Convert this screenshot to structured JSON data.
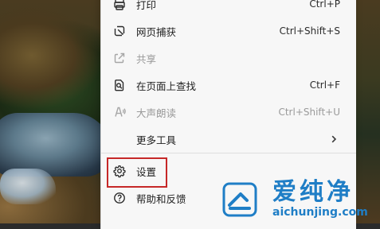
{
  "menu": {
    "items": [
      {
        "id": "print",
        "label": "打印",
        "shortcut": "Ctrl+P",
        "enabled": true,
        "icon": "printer-icon"
      },
      {
        "id": "web-capture",
        "label": "网页捕获",
        "shortcut": "Ctrl+Shift+S",
        "enabled": true,
        "icon": "web-capture-icon"
      },
      {
        "id": "share",
        "label": "共享",
        "shortcut": "",
        "enabled": false,
        "icon": "share-icon"
      },
      {
        "id": "find-on-page",
        "label": "在页面上查找",
        "shortcut": "Ctrl+F",
        "enabled": true,
        "icon": "find-on-page-icon"
      },
      {
        "id": "read-aloud",
        "label": "大声朗读",
        "shortcut": "Ctrl+Shift+U",
        "enabled": false,
        "icon": "read-aloud-icon"
      },
      {
        "id": "more-tools",
        "label": "更多工具",
        "shortcut": "",
        "enabled": true,
        "icon": ""
      },
      {
        "id": "settings",
        "label": "设置",
        "shortcut": "",
        "enabled": true,
        "icon": "gear-icon",
        "highlighted": true
      },
      {
        "id": "help-feedback",
        "label": "帮助和反馈",
        "shortcut": "",
        "enabled": true,
        "icon": "help-icon"
      }
    ]
  },
  "watermark": {
    "brand_cn": "爱纯净",
    "url": "aichunjing.com",
    "color": "#1f7ec6"
  },
  "colors": {
    "menu_bg": "#f7f7f7",
    "highlight_border": "#c62828",
    "disabled_text": "#9a9a9a"
  }
}
